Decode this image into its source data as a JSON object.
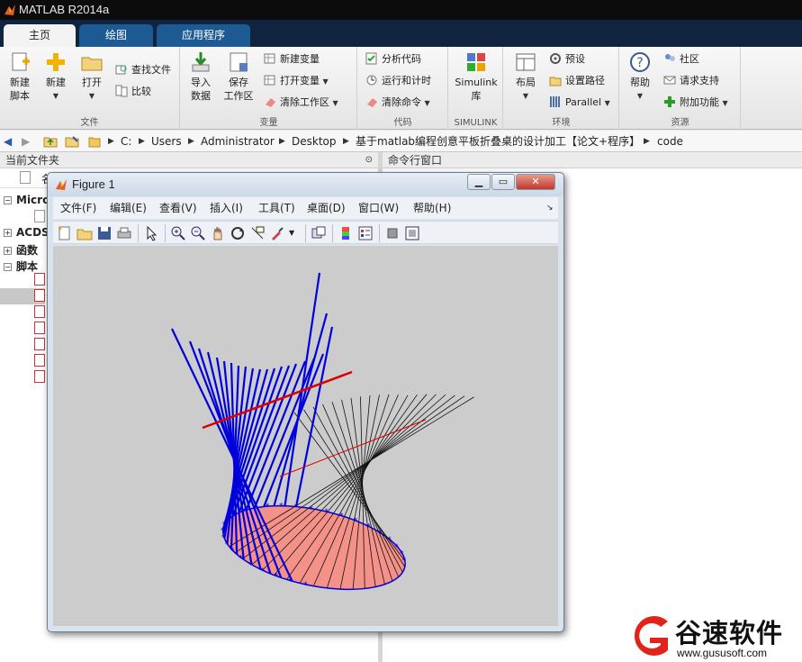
{
  "app": {
    "title": "MATLAB R2014a"
  },
  "tabs": [
    {
      "label": "主页"
    },
    {
      "label": "绘图"
    },
    {
      "label": "应用程序"
    }
  ],
  "ribbon": {
    "file_group": {
      "name": "文件",
      "new_script": "新建\n脚本",
      "new_script_l1": "新建",
      "new_script_l2": "脚本",
      "new": "新建",
      "open": "打开",
      "find_files": "查找文件",
      "compare": "比较"
    },
    "var_group": {
      "name": "变量",
      "import_l1": "导入",
      "import_l2": "数据",
      "save_l1": "保存",
      "save_l2": "工作区",
      "new_var": "新建变量",
      "open_var": "打开变量",
      "clear_ws": "清除工作区"
    },
    "code_group": {
      "name": "代码",
      "analyze": "分析代码",
      "run_time": "运行和计时",
      "clear_cmd": "清除命令"
    },
    "simulink_group": {
      "name": "SIMULINK",
      "lib_l1": "Simulink",
      "lib_l2": "库"
    },
    "env_group": {
      "name": "环境",
      "layout": "布局",
      "prefs": "预设",
      "set_path": "设置路径",
      "parallel": "Parallel"
    },
    "res_group": {
      "name": "资源",
      "help": "帮助",
      "community": "社区",
      "support": "请求支持",
      "addons": "附加功能"
    }
  },
  "address": {
    "crumbs": [
      "C:",
      "Users",
      "Administrator",
      "Desktop",
      "基于matlab编程创意平板折叠桌的设计加工【论文+程序】",
      "code"
    ]
  },
  "current_folder": {
    "title": "当前文件夹",
    "items": [
      "Micro",
      "ACDS",
      "函数",
      "脚本"
    ],
    "letter": "名"
  },
  "command_window": {
    "title": "命令行窗口"
  },
  "figure": {
    "title": "Figure 1",
    "menu": [
      "文件(F)",
      "编辑(E)",
      "查看(V)",
      "插入(I)",
      "工具(T)",
      "桌面(D)",
      "窗口(W)",
      "帮助(H)"
    ]
  },
  "watermark": {
    "brand": "谷速软件",
    "url": "www.gususoft.com"
  },
  "colors": {
    "legs_blue": "#0000dd",
    "thin_lines": "#111111",
    "red_bar": "#dd0000",
    "ellipse_fill": "#f4928a",
    "canvas_bg": "#cccccc"
  }
}
